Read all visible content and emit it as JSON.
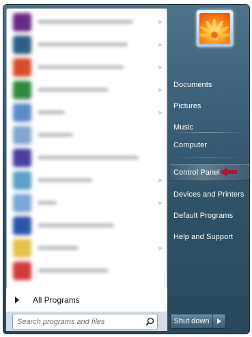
{
  "programs": [
    {
      "color": "#6b2a86"
    },
    {
      "color": "#2d5e85"
    },
    {
      "color": "#d94c2e"
    },
    {
      "color": "#2f8a3a"
    },
    {
      "color": "#5a8bc9"
    },
    {
      "color": "#7fa6cf"
    },
    {
      "color": "#4a3fa0"
    },
    {
      "color": "#5aa0c9"
    },
    {
      "color": "#7aa7d8"
    },
    {
      "color": "#2a55a8"
    },
    {
      "color": "#e6c24a"
    },
    {
      "color": "#d23a3a"
    }
  ],
  "all_programs_label": "All Programs",
  "search": {
    "placeholder": "Search programs and files"
  },
  "right_links": {
    "documents": "Documents",
    "pictures": "Pictures",
    "music": "Music",
    "computer": "Computer",
    "control_panel": "Control Panel",
    "devices_printers": "Devices and Printers",
    "default_programs": "Default Programs",
    "help_support": "Help and Support"
  },
  "shutdown_label": "Shut down",
  "colors": {
    "pointer": "#b3153a",
    "menu_dark": "#2f5064",
    "menu_light": "#4e7287"
  },
  "icons": {
    "all_programs": "right-triangle-icon",
    "search": "magnifier-icon",
    "shutdown_options": "chevron-right-icon",
    "annotation": "arrow-left-icon"
  }
}
